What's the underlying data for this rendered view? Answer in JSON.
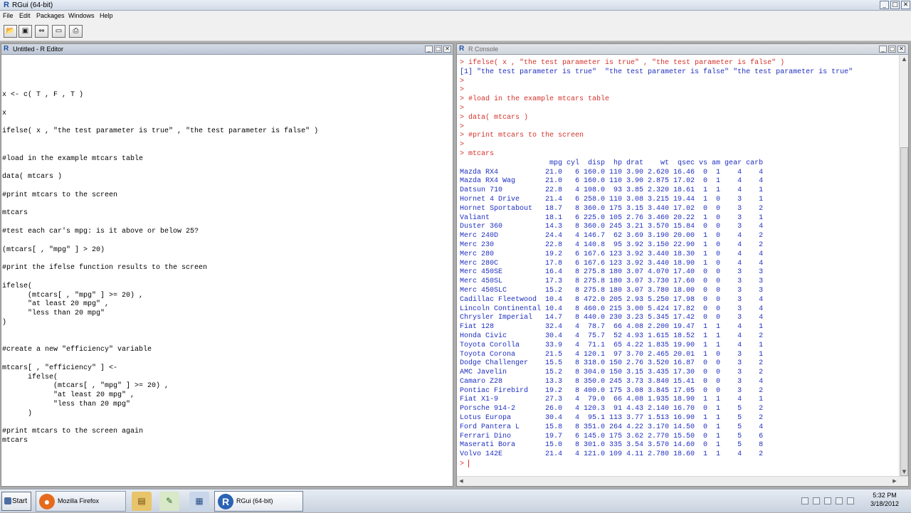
{
  "app": {
    "title": "RGui (64-bit)",
    "icon": "R"
  },
  "menu": [
    "File",
    "Edit",
    "Packages",
    "Windows",
    "Help"
  ],
  "toolbar": [
    "open-script-icon",
    "save-icon",
    "load-workspace-icon",
    "window-icon",
    "print-icon"
  ],
  "editor": {
    "title": "Untitled - R Editor",
    "code": [
      "",
      "",
      "",
      "",
      "",
      "x <- c( T , F , T )",
      "",
      "x",
      "",
      "ifelse( x , \"the test parameter is true\" , \"the test parameter is false\" )",
      "",
      "",
      "#load in the example mtcars table",
      "",
      "data( mtcars )",
      "",
      "#print mtcars to the screen",
      "",
      "mtcars",
      "",
      "#test each car's mpg: is it above or below 25?",
      "",
      "(mtcars[ , \"mpg\" ] > 20)",
      "",
      "#print the ifelse function results to the screen",
      "",
      "ifelse(",
      "      (mtcars[ , \"mpg\" ] >= 20) ,",
      "      \"at least 20 mpg\" ,",
      "      \"less than 20 mpg\"",
      ")",
      "",
      "",
      "#create a new \"efficiency\" variable",
      "",
      "mtcars[ , \"efficiency\" ] <-",
      "      ifelse(",
      "            (mtcars[ , \"mpg\" ] >= 20) ,",
      "            \"at least 20 mpg\" ,",
      "            \"less than 20 mpg\"",
      "      )",
      "",
      "#print mtcars to the screen again",
      "mtcars"
    ]
  },
  "console": {
    "title": "R Console",
    "lines": [
      {
        "t": "cmd",
        "s": "> ifelse( x , \"the test parameter is true\" , \"the test parameter is false\" )"
      },
      {
        "t": "out",
        "s": "[1] \"the test parameter is true\"  \"the test parameter is false\" \"the test parameter is true\""
      },
      {
        "t": "cmd",
        "s": ">"
      },
      {
        "t": "cmd",
        "s": ">"
      },
      {
        "t": "cmd",
        "s": "> #load in the example mtcars table"
      },
      {
        "t": "cmd",
        "s": ">"
      },
      {
        "t": "cmd",
        "s": "> data( mtcars )"
      },
      {
        "t": "cmd",
        "s": ">"
      },
      {
        "t": "cmd",
        "s": "> #print mtcars to the screen"
      },
      {
        "t": "cmd",
        "s": ">"
      },
      {
        "t": "cmd",
        "s": "> mtcars"
      },
      {
        "t": "out",
        "s": "                     mpg cyl  disp  hp drat    wt  qsec vs am gear carb"
      },
      {
        "t": "out",
        "s": "Mazda RX4           21.0   6 160.0 110 3.90 2.620 16.46  0  1    4    4"
      },
      {
        "t": "out",
        "s": "Mazda RX4 Wag       21.0   6 160.0 110 3.90 2.875 17.02  0  1    4    4"
      },
      {
        "t": "out",
        "s": "Datsun 710          22.8   4 108.0  93 3.85 2.320 18.61  1  1    4    1"
      },
      {
        "t": "out",
        "s": "Hornet 4 Drive      21.4   6 258.0 110 3.08 3.215 19.44  1  0    3    1"
      },
      {
        "t": "out",
        "s": "Hornet Sportabout   18.7   8 360.0 175 3.15 3.440 17.02  0  0    3    2"
      },
      {
        "t": "out",
        "s": "Valiant             18.1   6 225.0 105 2.76 3.460 20.22  1  0    3    1"
      },
      {
        "t": "out",
        "s": "Duster 360          14.3   8 360.0 245 3.21 3.570 15.84  0  0    3    4"
      },
      {
        "t": "out",
        "s": "Merc 240D           24.4   4 146.7  62 3.69 3.190 20.00  1  0    4    2"
      },
      {
        "t": "out",
        "s": "Merc 230            22.8   4 140.8  95 3.92 3.150 22.90  1  0    4    2"
      },
      {
        "t": "out",
        "s": "Merc 280            19.2   6 167.6 123 3.92 3.440 18.30  1  0    4    4"
      },
      {
        "t": "out",
        "s": "Merc 280C           17.8   6 167.6 123 3.92 3.440 18.90  1  0    4    4"
      },
      {
        "t": "out",
        "s": "Merc 450SE          16.4   8 275.8 180 3.07 4.070 17.40  0  0    3    3"
      },
      {
        "t": "out",
        "s": "Merc 450SL          17.3   8 275.8 180 3.07 3.730 17.60  0  0    3    3"
      },
      {
        "t": "out",
        "s": "Merc 450SLC         15.2   8 275.8 180 3.07 3.780 18.00  0  0    3    3"
      },
      {
        "t": "out",
        "s": "Cadillac Fleetwood  10.4   8 472.0 205 2.93 5.250 17.98  0  0    3    4"
      },
      {
        "t": "out",
        "s": "Lincoln Continental 10.4   8 460.0 215 3.00 5.424 17.82  0  0    3    4"
      },
      {
        "t": "out",
        "s": "Chrysler Imperial   14.7   8 440.0 230 3.23 5.345 17.42  0  0    3    4"
      },
      {
        "t": "out",
        "s": "Fiat 128            32.4   4  78.7  66 4.08 2.200 19.47  1  1    4    1"
      },
      {
        "t": "out",
        "s": "Honda Civic         30.4   4  75.7  52 4.93 1.615 18.52  1  1    4    2"
      },
      {
        "t": "out",
        "s": "Toyota Corolla      33.9   4  71.1  65 4.22 1.835 19.90  1  1    4    1"
      },
      {
        "t": "out",
        "s": "Toyota Corona       21.5   4 120.1  97 3.70 2.465 20.01  1  0    3    1"
      },
      {
        "t": "out",
        "s": "Dodge Challenger    15.5   8 318.0 150 2.76 3.520 16.87  0  0    3    2"
      },
      {
        "t": "out",
        "s": "AMC Javelin         15.2   8 304.0 150 3.15 3.435 17.30  0  0    3    2"
      },
      {
        "t": "out",
        "s": "Camaro Z28          13.3   8 350.0 245 3.73 3.840 15.41  0  0    3    4"
      },
      {
        "t": "out",
        "s": "Pontiac Firebird    19.2   8 400.0 175 3.08 3.845 17.05  0  0    3    2"
      },
      {
        "t": "out",
        "s": "Fiat X1-9           27.3   4  79.0  66 4.08 1.935 18.90  1  1    4    1"
      },
      {
        "t": "out",
        "s": "Porsche 914-2       26.0   4 120.3  91 4.43 2.140 16.70  0  1    5    2"
      },
      {
        "t": "out",
        "s": "Lotus Europa        30.4   4  95.1 113 3.77 1.513 16.90  1  1    5    2"
      },
      {
        "t": "out",
        "s": "Ford Pantera L      15.8   8 351.0 264 4.22 3.170 14.50  0  1    5    4"
      },
      {
        "t": "out",
        "s": "Ferrari Dino        19.7   6 145.0 175 3.62 2.770 15.50  0  1    5    6"
      },
      {
        "t": "out",
        "s": "Maserati Bora       15.0   8 301.0 335 3.54 3.570 14.60  0  1    5    8"
      },
      {
        "t": "out",
        "s": "Volvo 142E          21.4   4 121.0 109 4.11 2.780 18.60  1  1    4    2"
      }
    ],
    "prompt": ">"
  },
  "taskbar": {
    "start": "Start",
    "tasks": [
      {
        "label": "Mozilla Firefox",
        "icon": "firefox-icon"
      },
      {
        "label": "RGui (64-bit)",
        "icon": "r-icon"
      }
    ],
    "time": "5:32 PM",
    "date": "3/18/2012"
  }
}
